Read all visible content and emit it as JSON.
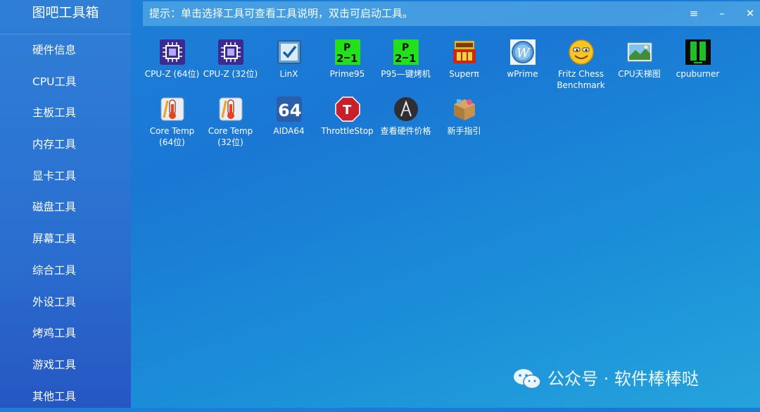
{
  "app": {
    "title": "图吧工具箱"
  },
  "sidebar": {
    "items": [
      {
        "label": "硬件信息"
      },
      {
        "label": "CPU工具"
      },
      {
        "label": "主板工具"
      },
      {
        "label": "内存工具"
      },
      {
        "label": "显卡工具"
      },
      {
        "label": "磁盘工具"
      },
      {
        "label": "屏幕工具"
      },
      {
        "label": "综合工具"
      },
      {
        "label": "外设工具"
      },
      {
        "label": "烤鸡工具"
      },
      {
        "label": "游戏工具"
      },
      {
        "label": "其他工具"
      }
    ]
  },
  "topbar": {
    "hint": "提示：单击选择工具可查看工具说明，双击可启动工具。",
    "menu_glyph": "≡",
    "min_glyph": "–",
    "close_glyph": "✕"
  },
  "tools": [
    {
      "label": "CPU-Z (64位)",
      "icon": "cpuz-icon"
    },
    {
      "label": "CPU-Z (32位)",
      "icon": "cpuz-icon"
    },
    {
      "label": "LinX",
      "icon": "checkbox-icon"
    },
    {
      "label": "Prime95",
      "icon": "prime95-icon"
    },
    {
      "label": "P95—键烤机",
      "icon": "prime95-icon"
    },
    {
      "label": "Superπ",
      "icon": "superpi-icon"
    },
    {
      "label": "wPrime",
      "icon": "wprime-icon"
    },
    {
      "label": "Fritz Chess\nBenchmark",
      "icon": "smiley-icon"
    },
    {
      "label": "CPU天梯图",
      "icon": "landscape-icon"
    },
    {
      "label": "cpuburner",
      "icon": "cpuburner-icon"
    },
    {
      "label": "Core Temp\n(64位)",
      "icon": "thermometer-icon"
    },
    {
      "label": "Core Temp\n(32位)",
      "icon": "thermometer-icon"
    },
    {
      "label": "AIDA64",
      "icon": "aida64-icon",
      "icon_text": "64"
    },
    {
      "label": "ThrottleStop",
      "icon": "stop-sign-icon",
      "icon_text": "T"
    },
    {
      "label": "查看硬件价格",
      "icon": "price-icon"
    },
    {
      "label": "新手指引",
      "icon": "package-icon"
    }
  ],
  "watermark": {
    "text": "公众号 · 软件棒棒哒"
  }
}
